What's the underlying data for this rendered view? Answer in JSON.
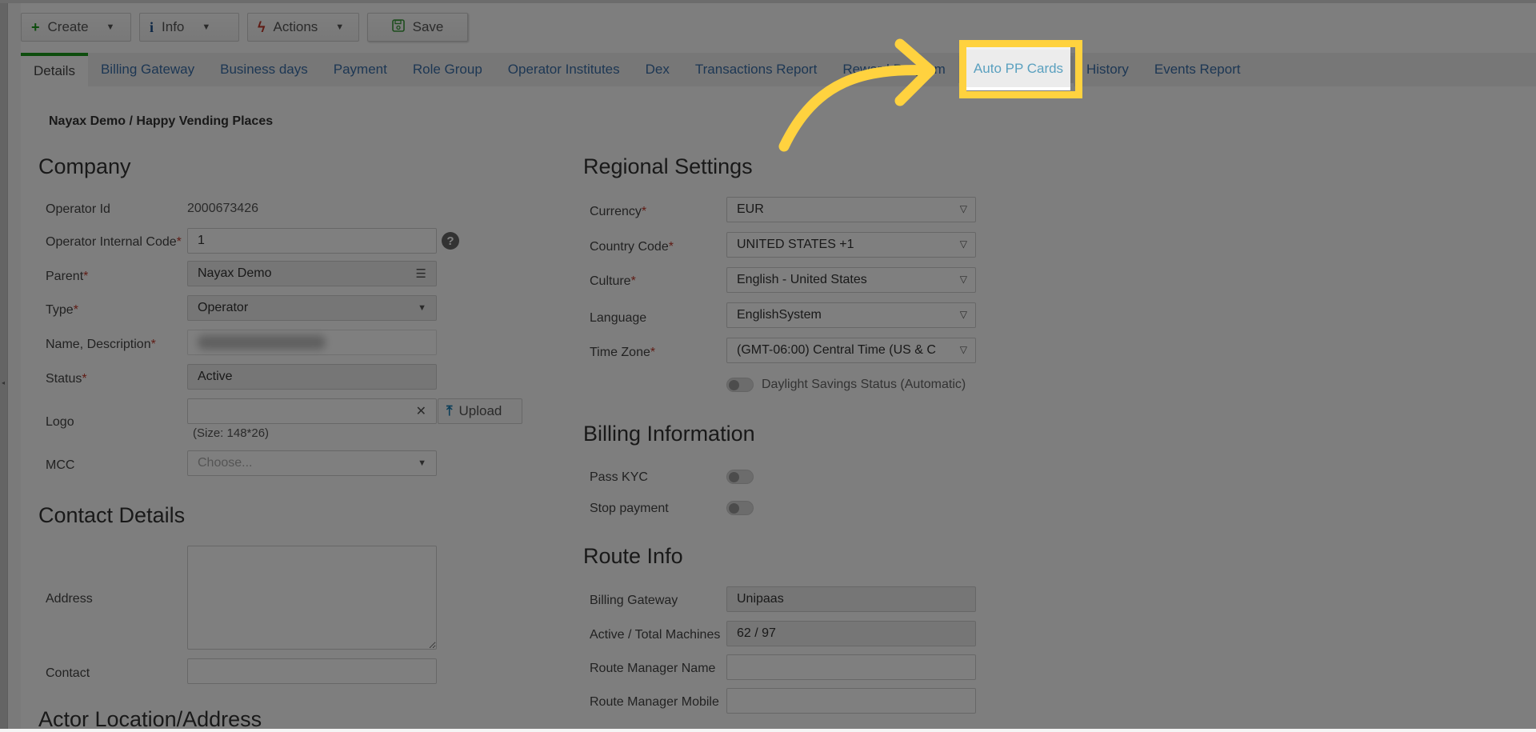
{
  "toolbar": {
    "create": {
      "label": "Create",
      "icon": "plus-icon",
      "icon_color": "#1b9a1b"
    },
    "info": {
      "label": "Info",
      "icon": "info-icon",
      "icon_color": "#1b4f8a"
    },
    "actions": {
      "label": "Actions",
      "icon": "lightning-icon",
      "icon_color": "#c0392b"
    },
    "save": {
      "label": "Save",
      "icon": "floppy-disk-icon",
      "icon_color": "#3a9a3a"
    }
  },
  "tabs": [
    {
      "label": "Details",
      "active": true
    },
    {
      "label": "Billing Gateway"
    },
    {
      "label": "Business days"
    },
    {
      "label": "Payment"
    },
    {
      "label": "Role Group"
    },
    {
      "label": "Operator Institutes"
    },
    {
      "label": "Dex"
    },
    {
      "label": "Transactions Report"
    },
    {
      "label": "Reward Program"
    },
    {
      "label": "Auto PP Cards",
      "highlighted": true
    },
    {
      "label": "History"
    },
    {
      "label": "Events Report"
    }
  ],
  "breadcrumb": "Nayax Demo / Happy Vending Places",
  "company": {
    "title": "Company",
    "operator_id": {
      "label": "Operator Id",
      "value": "2000673426"
    },
    "internal_code": {
      "label": "Operator Internal Code",
      "value": "1"
    },
    "parent": {
      "label": "Parent",
      "value": "Nayax Demo"
    },
    "type": {
      "label": "Type",
      "value": "Operator"
    },
    "name": {
      "label": "Name, Description",
      "value": ""
    },
    "status": {
      "label": "Status",
      "value": "Active"
    },
    "logo": {
      "label": "Logo",
      "upload_label": "Upload",
      "hint": "(Size: 148*26)"
    },
    "mcc": {
      "label": "MCC",
      "placeholder": "Choose..."
    }
  },
  "contact": {
    "title": "Contact Details",
    "address": {
      "label": "Address",
      "value": ""
    },
    "contact": {
      "label": "Contact",
      "value": ""
    }
  },
  "actor_location": {
    "title": "Actor Location/Address"
  },
  "regional": {
    "title": "Regional Settings",
    "currency": {
      "label": "Currency",
      "value": "EUR"
    },
    "country_code": {
      "label": "Country Code",
      "value": "UNITED STATES +1"
    },
    "culture": {
      "label": "Culture",
      "value": "English - United States"
    },
    "language": {
      "label": "Language",
      "value": "EnglishSystem"
    },
    "time_zone": {
      "label": "Time Zone",
      "value": "(GMT-06:00) Central Time (US & C"
    },
    "daylight": {
      "label": "Daylight Savings Status (Automatic)",
      "on": false
    }
  },
  "billing": {
    "title": "Billing Information",
    "pass_kyc": {
      "label": "Pass KYC",
      "on": false
    },
    "stop_payment": {
      "label": "Stop payment",
      "on": false
    }
  },
  "route": {
    "title": "Route Info",
    "billing_gateway": {
      "label": "Billing Gateway",
      "value": "Unipaas"
    },
    "machines": {
      "label": "Active / Total Machines",
      "value": "62 / 97"
    },
    "manager_name": {
      "label": "Route Manager Name",
      "value": ""
    },
    "manager_mobile": {
      "label": "Route Manager Mobile",
      "value": ""
    }
  },
  "annotation": {
    "highlight_color": "#ffd23f",
    "target_tab": "Auto PP Cards"
  }
}
